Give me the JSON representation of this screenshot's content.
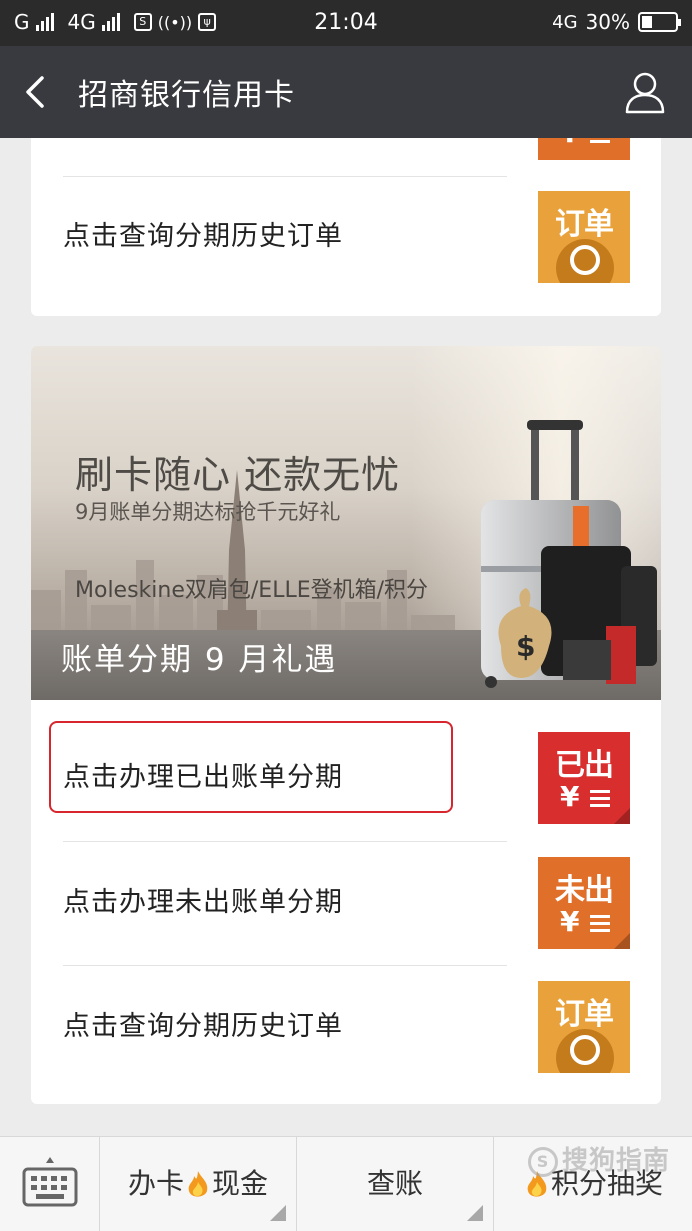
{
  "status_bar": {
    "carrier_left": "G",
    "network_2": "4G",
    "time": "21:04",
    "network_right": "4G",
    "battery_text": "30%",
    "battery_level": 0.3
  },
  "nav": {
    "title": "招商银行信用卡"
  },
  "card_top": {
    "rows": [
      {
        "label": "点击查询分期历史订单",
        "tile_text": "订单",
        "tile_color": "#e9a23b"
      }
    ]
  },
  "banner": {
    "title": "刷卡随心 还款无忧",
    "subtitle": "9月账单分期达标抢千元好礼",
    "items": "Moleskine双肩包/ELLE登机箱/积分",
    "tag": "账单分期  9 月礼遇"
  },
  "card_main": {
    "rows": [
      {
        "label": "点击办理已出账单分期",
        "tile_text": "已出",
        "tile_color": "#d92e2e",
        "tile_symbol": "¥"
      },
      {
        "label": "点击办理未出账单分期",
        "tile_text": "未出",
        "tile_color": "#e06f2a",
        "tile_symbol": "¥"
      },
      {
        "label": "点击查询分期历史订单",
        "tile_text": "订单",
        "tile_color": "#e9a23b"
      }
    ]
  },
  "bottom_bar": {
    "tab1_a": "办卡",
    "tab1_b": "现金",
    "tab2": "查账",
    "tab3": "积分抽奖"
  },
  "watermark": "搜狗指南",
  "colors": {
    "nav_bg": "#393a3f",
    "status_bg": "#2b2b2b",
    "highlight_border": "#d7262e"
  }
}
